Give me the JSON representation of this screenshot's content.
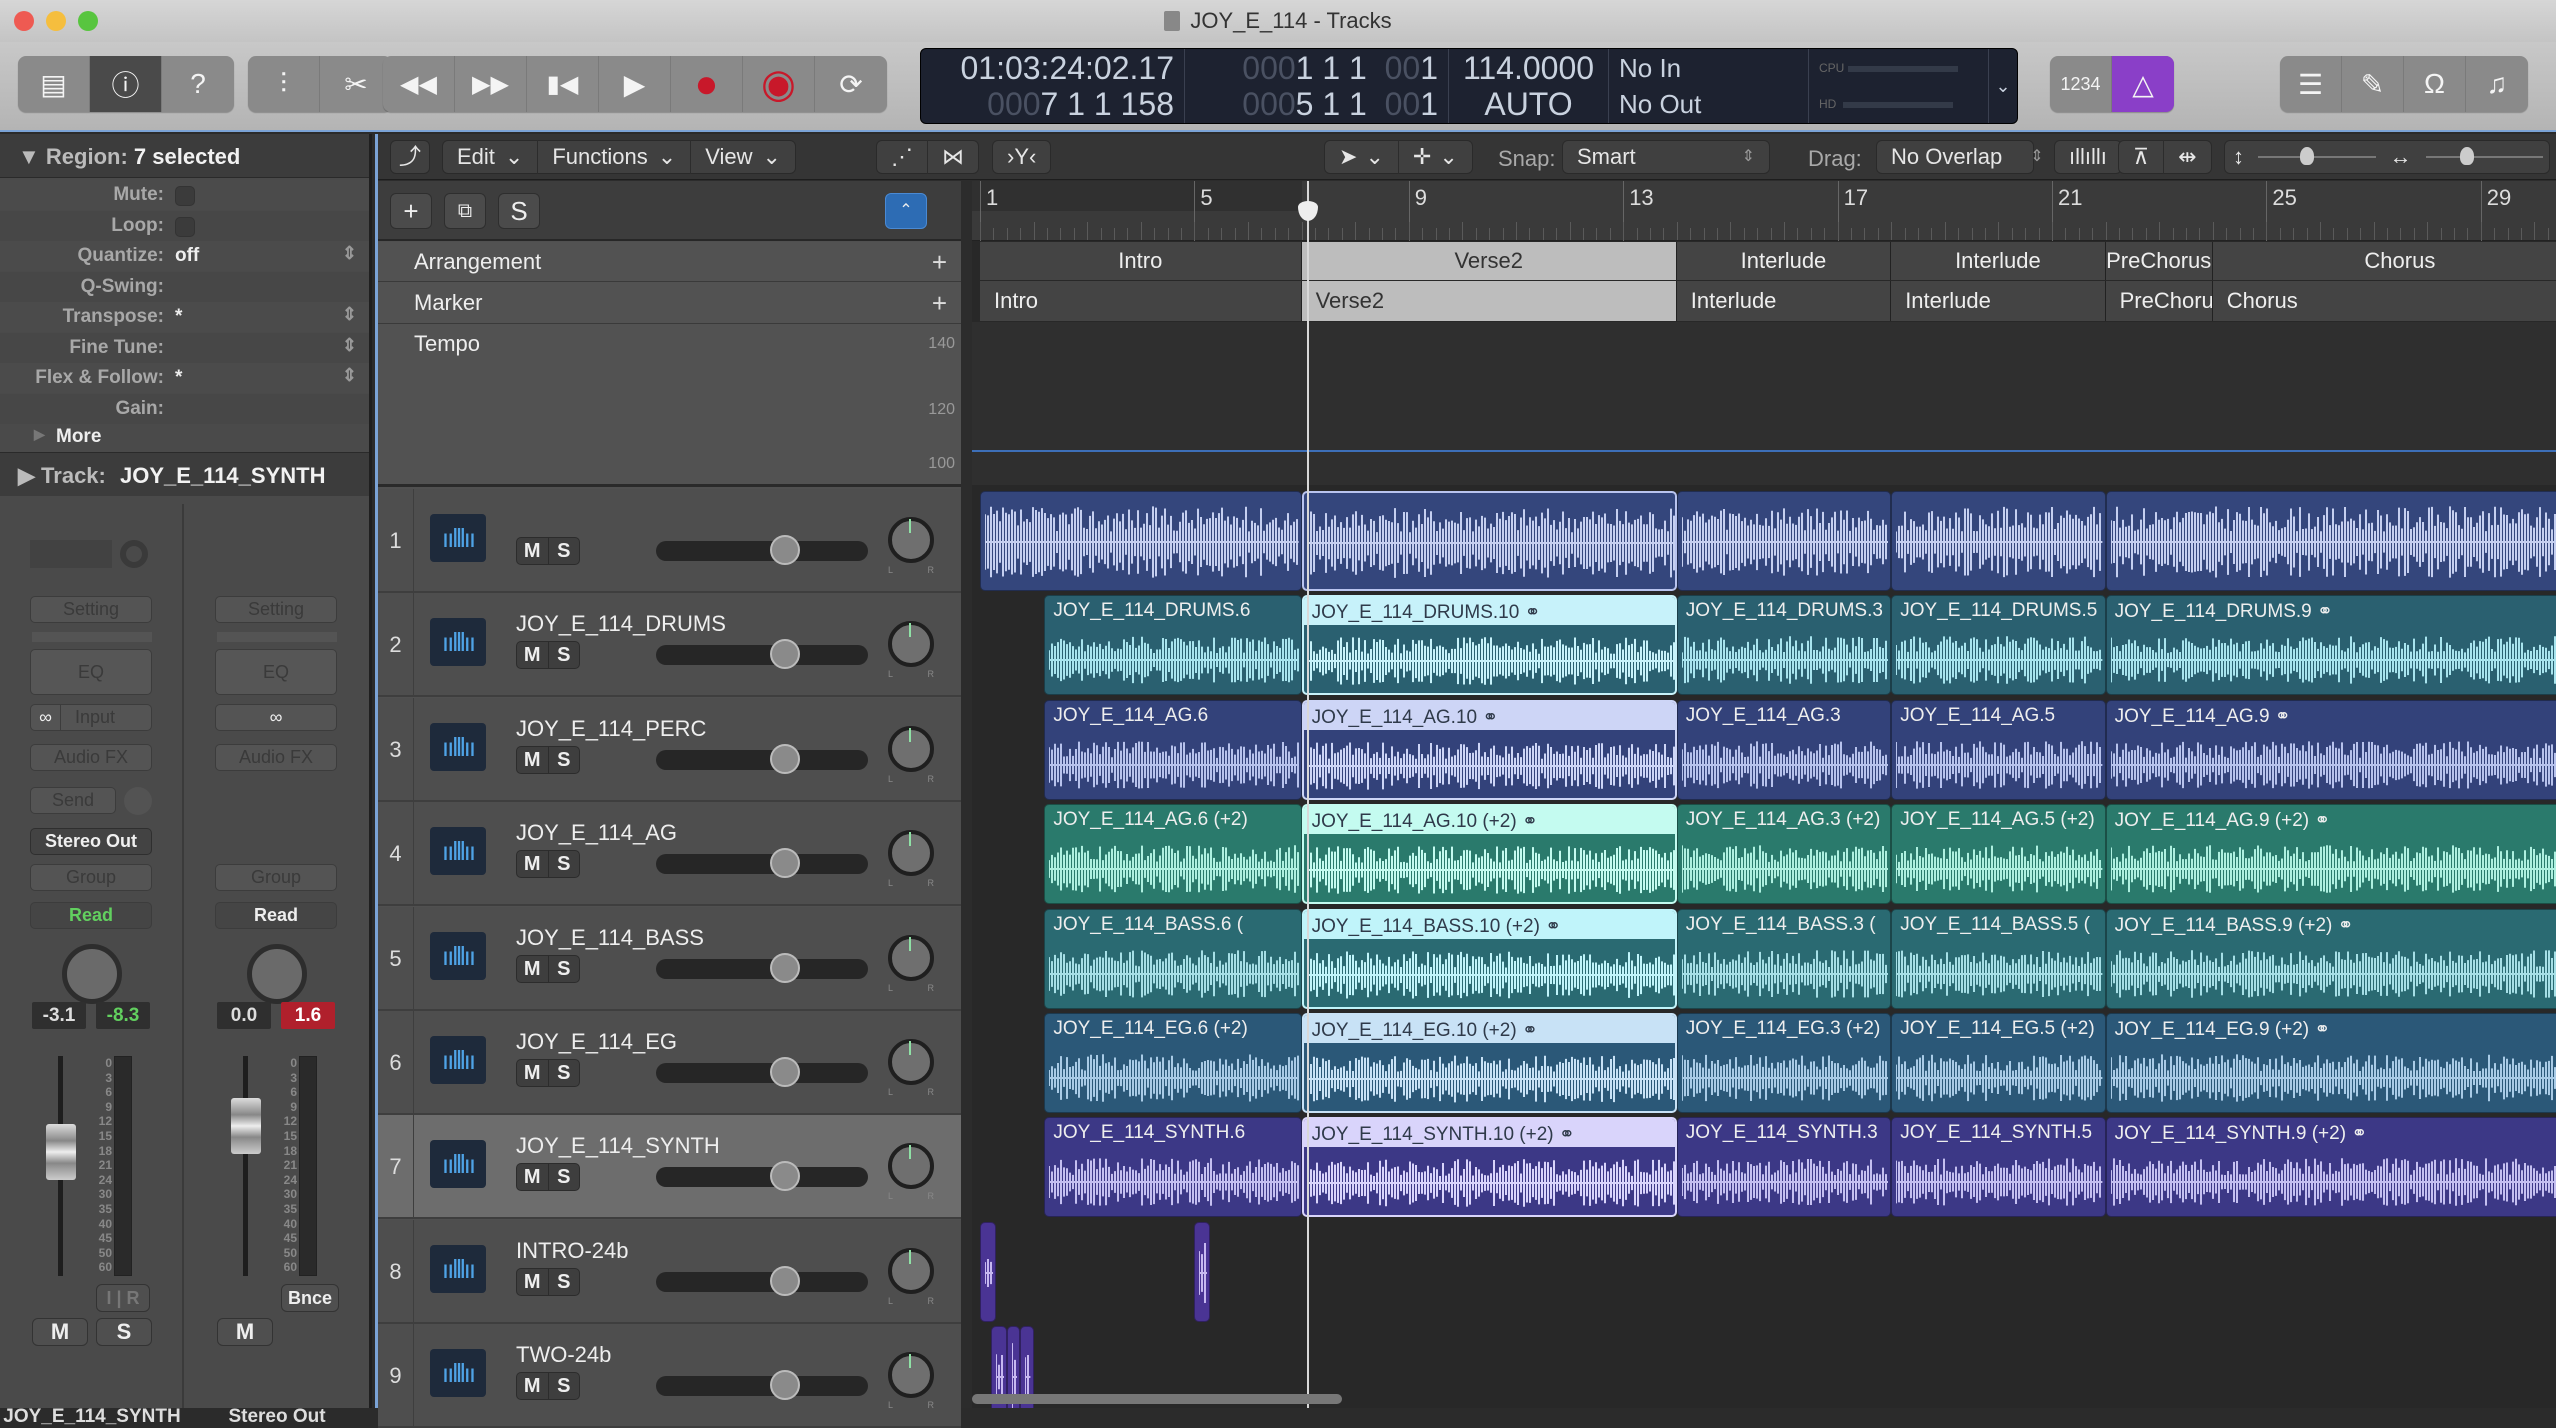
{
  "window": {
    "title": "JOY_E_114 - Tracks"
  },
  "toolbar": {
    "left_buttons": [
      {
        "name": "library-button",
        "icon": "library-icon",
        "glyph": "▤"
      },
      {
        "name": "inspector-button",
        "icon": "info-icon",
        "glyph": "ⓘ"
      },
      {
        "name": "quick-help-button",
        "icon": "help-icon",
        "glyph": "?"
      }
    ],
    "edit_buttons": [
      {
        "name": "mixer-button",
        "icon": "sliders-icon",
        "glyph": "⫶"
      },
      {
        "name": "editors-button",
        "icon": "scissors-icon",
        "glyph": "✂"
      }
    ],
    "transport": [
      {
        "name": "rewind-button",
        "icon": "rewind-icon",
        "glyph": "◀◀"
      },
      {
        "name": "fast-forward-button",
        "icon": "fast-forward-icon",
        "glyph": "▶▶"
      },
      {
        "name": "go-to-start-button",
        "icon": "skip-back-icon",
        "glyph": "▮◀"
      },
      {
        "name": "play-button",
        "icon": "play-icon",
        "glyph": "▶"
      },
      {
        "name": "record-button",
        "icon": "record-icon",
        "glyph": "●"
      },
      {
        "name": "capture-record-button",
        "icon": "capture-record-icon",
        "glyph": "◉"
      },
      {
        "name": "cycle-button",
        "icon": "cycle-icon",
        "glyph": "⟳"
      }
    ],
    "lcd": {
      "smpte": "01:03:24:02.17",
      "bars_prefix": "000",
      "bars": "7  1  1  158",
      "left_locator_prefix": "000",
      "left_locator": "1  1  1",
      "left_locator_ticks_prefix": "00",
      "left_locator_ticks": "1",
      "right_locator_prefix": "000",
      "right_locator": "5  1  1",
      "right_locator_ticks_prefix": "00",
      "right_locator_ticks": "1",
      "tempo": "114.0000",
      "tempo_mode": "AUTO",
      "midi_in": "No In",
      "midi_out": "No Out",
      "cpu_label": "CPU",
      "hd_label": "HD"
    },
    "count_in_label": "1234",
    "metronome_icon": "metronome-icon",
    "right_buttons": [
      {
        "name": "list-editors-button",
        "icon": "list-icon",
        "glyph": "☰"
      },
      {
        "name": "notepad-button",
        "icon": "notepad-icon",
        "glyph": "✎"
      },
      {
        "name": "loop-browser-button",
        "icon": "loop-icon",
        "glyph": "Ω"
      },
      {
        "name": "browser-button",
        "icon": "media-browser-icon",
        "glyph": "♫"
      }
    ]
  },
  "inspector": {
    "region_label": "Region:",
    "region_value": "7 selected",
    "params": [
      {
        "label": "Mute:",
        "type": "checkbox"
      },
      {
        "label": "Loop:",
        "type": "checkbox"
      },
      {
        "label": "Quantize:",
        "value": "off",
        "stepper": true
      },
      {
        "label": "Q-Swing:",
        "value": ""
      },
      {
        "label": "Transpose:",
        "value": "*",
        "stepper": true
      },
      {
        "label": "Fine Tune:",
        "value": "",
        "stepper": true
      },
      {
        "label": "Flex & Follow:",
        "value": "*",
        "stepper": true
      },
      {
        "label": "Gain:",
        "value": ""
      }
    ],
    "more_label": "More",
    "track_label": "Track:",
    "track_value": "JOY_E_114_SYNTH",
    "strips": [
      {
        "name": "JOY_E_114_SYNTH",
        "setting": "Setting",
        "eq": "EQ",
        "input": "Input",
        "audio_fx": "Audio FX",
        "send": "Send",
        "output": "Stereo Out",
        "group": "Group",
        "automation": "Read",
        "volume": "-3.1",
        "peak": "-8.3",
        "mute": "M",
        "solo": "S",
        "input_mon": "I",
        "rec": "R"
      },
      {
        "name": "Stereo Out",
        "setting": "Setting",
        "eq": "EQ",
        "audio_fx": "Audio FX",
        "group": "Group",
        "automation": "Read",
        "volume": "0.0",
        "peak": "1.6",
        "mute": "M",
        "bounce": "Bnce"
      }
    ],
    "meter_scale": [
      "0",
      "3",
      "6",
      "9",
      "12",
      "15",
      "18",
      "21",
      "24",
      "30",
      "35",
      "40",
      "45",
      "50",
      "60"
    ]
  },
  "tracks_toolbar": {
    "menus": [
      "Edit",
      "Functions",
      "View"
    ],
    "snap_label": "Snap:",
    "snap_value": "Smart",
    "drag_label": "Drag:",
    "drag_value": "No Overlap"
  },
  "global_tracks": {
    "arrangement_label": "Arrangement",
    "marker_label": "Marker",
    "tempo_label": "Tempo",
    "tempo_scale": [
      "140",
      "120",
      "100"
    ]
  },
  "ruler": {
    "bars": [
      "1",
      "5",
      "9",
      "13",
      "17",
      "21",
      "25",
      "29"
    ]
  },
  "arrangement": [
    {
      "label": "Intro",
      "start": 1,
      "end": 7,
      "selected": false
    },
    {
      "label": "Verse2",
      "start": 7,
      "end": 14,
      "selected": true
    },
    {
      "label": "Interlude",
      "start": 14,
      "end": 18,
      "selected": false
    },
    {
      "label": "Interlude",
      "start": 18,
      "end": 22,
      "selected": false
    },
    {
      "label": "PreChorus",
      "start": 22,
      "end": 24,
      "selected": false
    },
    {
      "label": "Chorus",
      "start": 24,
      "end": 31,
      "selected": false
    }
  ],
  "markers": [
    {
      "label": "Intro",
      "start": 1,
      "end": 7,
      "selected": false
    },
    {
      "label": "Verse2",
      "start": 7,
      "end": 14,
      "selected": true
    },
    {
      "label": "Interlude",
      "start": 14,
      "end": 18,
      "selected": false
    },
    {
      "label": "Interlude",
      "start": 18,
      "end": 22,
      "selected": false
    },
    {
      "label": "PreChorus",
      "start": 22,
      "end": 24,
      "selected": false
    },
    {
      "label": "Chorus",
      "start": 24,
      "end": 31,
      "selected": false
    }
  ],
  "playhead_bar": 7.1,
  "tracks": [
    {
      "num": "1",
      "name": "",
      "mute": "M",
      "solo": "S",
      "selected": false,
      "color": "#34467c",
      "wave": "#c5cff0",
      "regions": [
        {
          "name": "",
          "start": 1,
          "end": 7,
          "sel": false
        },
        {
          "name": "",
          "start": 7,
          "end": 14,
          "sel": true
        },
        {
          "name": "",
          "start": 14,
          "end": 18,
          "sel": false
        },
        {
          "name": "",
          "start": 18,
          "end": 22,
          "sel": false
        },
        {
          "name": "",
          "start": 22,
          "end": 31,
          "sel": false
        }
      ]
    },
    {
      "num": "2",
      "name": "JOY_E_114_DRUMS",
      "mute": "M",
      "solo": "S",
      "selected": false,
      "color": "#2a6070",
      "wave": "#a8e4ee",
      "selcolor": "#c7f2fa",
      "regions": [
        {
          "name": "JOY_E_114_DRUMS.6",
          "start": 2.2,
          "end": 7,
          "sel": false
        },
        {
          "name": "JOY_E_114_DRUMS.10",
          "start": 7,
          "end": 14,
          "sel": true,
          "link": true
        },
        {
          "name": "JOY_E_114_DRUMS.3",
          "start": 14,
          "end": 18,
          "sel": false
        },
        {
          "name": "JOY_E_114_DRUMS.5",
          "start": 18,
          "end": 22,
          "sel": false
        },
        {
          "name": "JOY_E_114_DRUMS.9",
          "start": 22,
          "end": 31,
          "sel": false,
          "link": true
        }
      ]
    },
    {
      "num": "3",
      "name": "JOY_E_114_PERC",
      "mute": "M",
      "solo": "S",
      "selected": false,
      "color": "#33427a",
      "wave": "#b7c2ec",
      "selcolor": "#cdd5f6",
      "regions": [
        {
          "name": "JOY_E_114_AG.6",
          "start": 2.2,
          "end": 7,
          "sel": false
        },
        {
          "name": "JOY_E_114_AG.10",
          "start": 7,
          "end": 14,
          "sel": true,
          "link": true
        },
        {
          "name": "JOY_E_114_AG.3",
          "start": 14,
          "end": 18,
          "sel": false
        },
        {
          "name": "JOY_E_114_AG.5",
          "start": 18,
          "end": 22,
          "sel": false
        },
        {
          "name": "JOY_E_114_AG.9",
          "start": 22,
          "end": 31,
          "sel": false,
          "link": true
        }
      ]
    },
    {
      "num": "4",
      "name": "JOY_E_114_AG",
      "mute": "M",
      "solo": "S",
      "selected": false,
      "color": "#2a7a6c",
      "wave": "#aef0e0",
      "selcolor": "#c4fbf0",
      "regions": [
        {
          "name": "JOY_E_114_AG.6 (+2)",
          "start": 2.2,
          "end": 7,
          "sel": false
        },
        {
          "name": "JOY_E_114_AG.10 (+2)",
          "start": 7,
          "end": 14,
          "sel": true,
          "link": true
        },
        {
          "name": "JOY_E_114_AG.3 (+2)",
          "start": 14,
          "end": 18,
          "sel": false
        },
        {
          "name": "JOY_E_114_AG.5 (+2)",
          "start": 18,
          "end": 22,
          "sel": false
        },
        {
          "name": "JOY_E_114_AG.9 (+2)",
          "start": 22,
          "end": 31,
          "sel": false,
          "link": true
        }
      ]
    },
    {
      "num": "5",
      "name": "JOY_E_114_BASS",
      "mute": "M",
      "solo": "S",
      "selected": false,
      "color": "#2a6a72",
      "wave": "#a6dfe6",
      "selcolor": "#c0f4fa",
      "regions": [
        {
          "name": "JOY_E_114_BASS.6 (",
          "start": 2.2,
          "end": 7,
          "sel": false
        },
        {
          "name": "JOY_E_114_BASS.10 (+2)",
          "start": 7,
          "end": 14,
          "sel": true,
          "link": true
        },
        {
          "name": "JOY_E_114_BASS.3 (",
          "start": 14,
          "end": 18,
          "sel": false
        },
        {
          "name": "JOY_E_114_BASS.5 (",
          "start": 18,
          "end": 22,
          "sel": false
        },
        {
          "name": "JOY_E_114_BASS.9 (+2)",
          "start": 22,
          "end": 31,
          "sel": false,
          "link": true
        }
      ]
    },
    {
      "num": "6",
      "name": "JOY_E_114_EG",
      "mute": "M",
      "solo": "S",
      "selected": false,
      "color": "#2b5878",
      "wave": "#a9cbe6",
      "selcolor": "#c8e2f6",
      "regions": [
        {
          "name": "JOY_E_114_EG.6 (+2)",
          "start": 2.2,
          "end": 7,
          "sel": false
        },
        {
          "name": "JOY_E_114_EG.10 (+2)",
          "start": 7,
          "end": 14,
          "sel": true,
          "link": true
        },
        {
          "name": "JOY_E_114_EG.3 (+2)",
          "start": 14,
          "end": 18,
          "sel": false
        },
        {
          "name": "JOY_E_114_EG.5 (+2)",
          "start": 18,
          "end": 22,
          "sel": false
        },
        {
          "name": "JOY_E_114_EG.9 (+2)",
          "start": 22,
          "end": 31,
          "sel": false,
          "link": true
        }
      ]
    },
    {
      "num": "7",
      "name": "JOY_E_114_SYNTH",
      "mute": "M",
      "solo": "S",
      "selected": true,
      "color": "#3c3886",
      "wave": "#c4bff0",
      "selcolor": "#d9d4fb",
      "regions": [
        {
          "name": "JOY_E_114_SYNTH.6",
          "start": 2.2,
          "end": 7,
          "sel": false
        },
        {
          "name": "JOY_E_114_SYNTH.10 (+2)",
          "start": 7,
          "end": 14,
          "sel": true,
          "link": true
        },
        {
          "name": "JOY_E_114_SYNTH.3",
          "start": 14,
          "end": 18,
          "sel": false
        },
        {
          "name": "JOY_E_114_SYNTH.5",
          "start": 18,
          "end": 22,
          "sel": false
        },
        {
          "name": "JOY_E_114_SYNTH.9 (+2)",
          "start": 22,
          "end": 31,
          "sel": false,
          "link": true
        }
      ]
    },
    {
      "num": "8",
      "name": "INTRO-24b",
      "mute": "M",
      "solo": "S",
      "selected": false,
      "color": "#4a3494",
      "wave": "#c6b8f0",
      "regions": [
        {
          "name": "",
          "start": 1,
          "end": 1.3,
          "sel": false
        },
        {
          "name": "",
          "start": 5,
          "end": 5.3,
          "sel": false
        }
      ]
    },
    {
      "num": "9",
      "name": "TWO-24b",
      "mute": "M",
      "solo": "S",
      "selected": false,
      "color": "#4a3494",
      "wave": "#c6b8f0",
      "regions": [
        {
          "name": "",
          "start": 1.2,
          "end": 1.5,
          "sel": false
        },
        {
          "name": "",
          "start": 1.5,
          "end": 1.75,
          "sel": false
        },
        {
          "name": "",
          "start": 1.75,
          "end": 2.0,
          "sel": false
        }
      ]
    }
  ]
}
